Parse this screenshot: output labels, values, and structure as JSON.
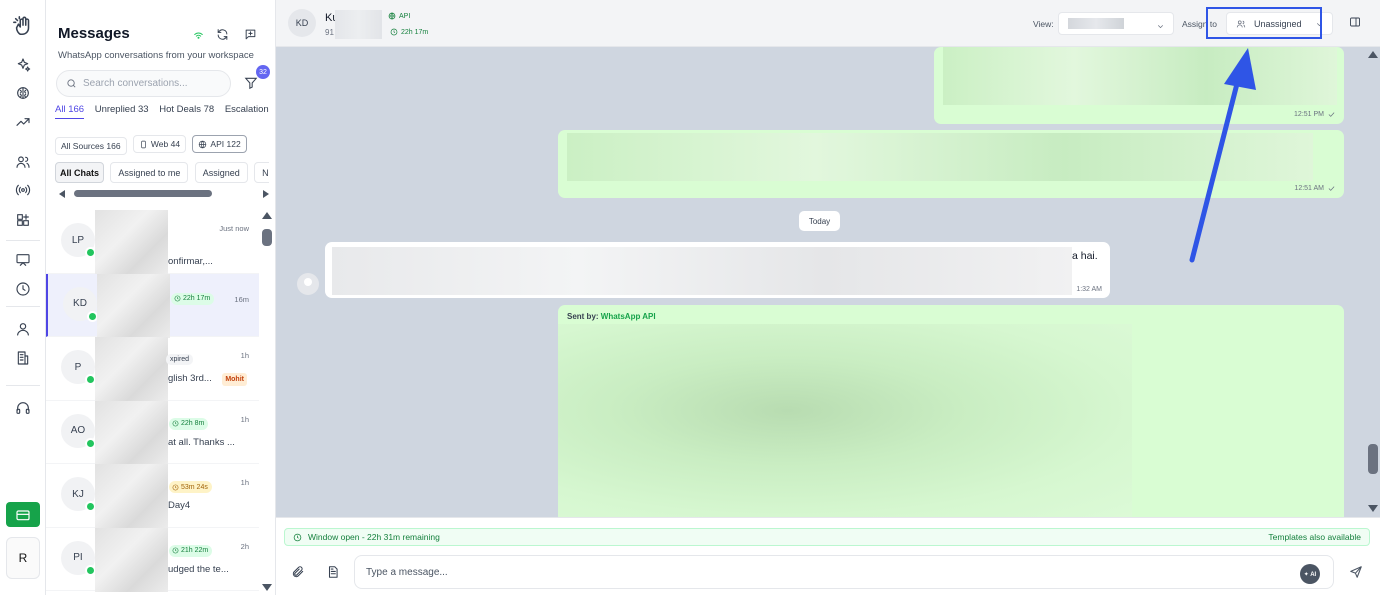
{
  "app": {
    "colors": {
      "accent": "#4f46e5",
      "whatsapp_green": "#22c55e",
      "out_bubble": "#d9fdd3",
      "chat_bg": "#cfd6e0",
      "highlight": "#2f55e6"
    },
    "profile_label": "R"
  },
  "rail": {
    "icons": [
      "logo-icon",
      "sparkles-icon",
      "brain-icon",
      "trending-icon",
      "users-icon",
      "broadcast-icon",
      "widgets-icon",
      "screen-icon",
      "clock-icon",
      "person-icon",
      "building-icon",
      "headset-icon",
      "credit-card-icon"
    ]
  },
  "list": {
    "title": "Messages",
    "subtitle": "WhatsApp conversations from your workspace",
    "search_placeholder": "Search conversations...",
    "filter_badge": "32",
    "tabs": [
      {
        "label": "All",
        "count": "166"
      },
      {
        "label": "Unreplied",
        "count": "33"
      },
      {
        "label": "Hot Deals",
        "count": "78"
      },
      {
        "label": "Escalation",
        "count": ""
      }
    ],
    "sources": [
      {
        "label": "All Sources",
        "count": "166"
      },
      {
        "label": "Web",
        "count": "44"
      },
      {
        "label": "API",
        "count": "122"
      }
    ],
    "filters": [
      "All Chats",
      "Assigned to me",
      "Assigned",
      "Ne"
    ],
    "rows": [
      {
        "initials": "LP",
        "time": "Just now",
        "preview": "onfirmar,...",
        "timer": "",
        "tag": "",
        "agent": ""
      },
      {
        "initials": "KD",
        "time": "16m",
        "preview": "",
        "timer": "22h 17m",
        "tag": "",
        "agent": ""
      },
      {
        "initials": "P",
        "time": "1h",
        "preview": "glish 3rd...",
        "timer": "",
        "tag": "xpired",
        "agent": "Mohit"
      },
      {
        "initials": "AO",
        "time": "1h",
        "preview": "at all. Thanks ...",
        "timer": "22h 8m",
        "tag": "",
        "agent": ""
      },
      {
        "initials": "KJ",
        "time": "1h",
        "preview": "Day4",
        "timer": "53m 24s",
        "tag": "",
        "agent": ""
      },
      {
        "initials": "PI",
        "time": "2h",
        "preview": "udged the te...",
        "timer": "21h 22m",
        "tag": "",
        "agent": ""
      }
    ]
  },
  "chat": {
    "header": {
      "initials": "KD",
      "name": "Ku",
      "phone": "91",
      "source": "API",
      "timer": "22h 17m",
      "view_label": "View:",
      "assign_label": "Assign to",
      "assignee": "Unassigned"
    },
    "day_divider": "Today",
    "messages": [
      {
        "time": "12:51 PM"
      },
      {
        "time": "12:51 AM"
      },
      {
        "text": "a hai.",
        "time": "1:32 AM"
      },
      {
        "sent_by_label": "Sent by:",
        "sent_by": "WhatsApp API"
      }
    ],
    "window_status": "Window open - 22h 31m remaining",
    "templates_note": "Templates also available",
    "input_placeholder": "Type a message...",
    "ai_label": "✦ AI"
  }
}
